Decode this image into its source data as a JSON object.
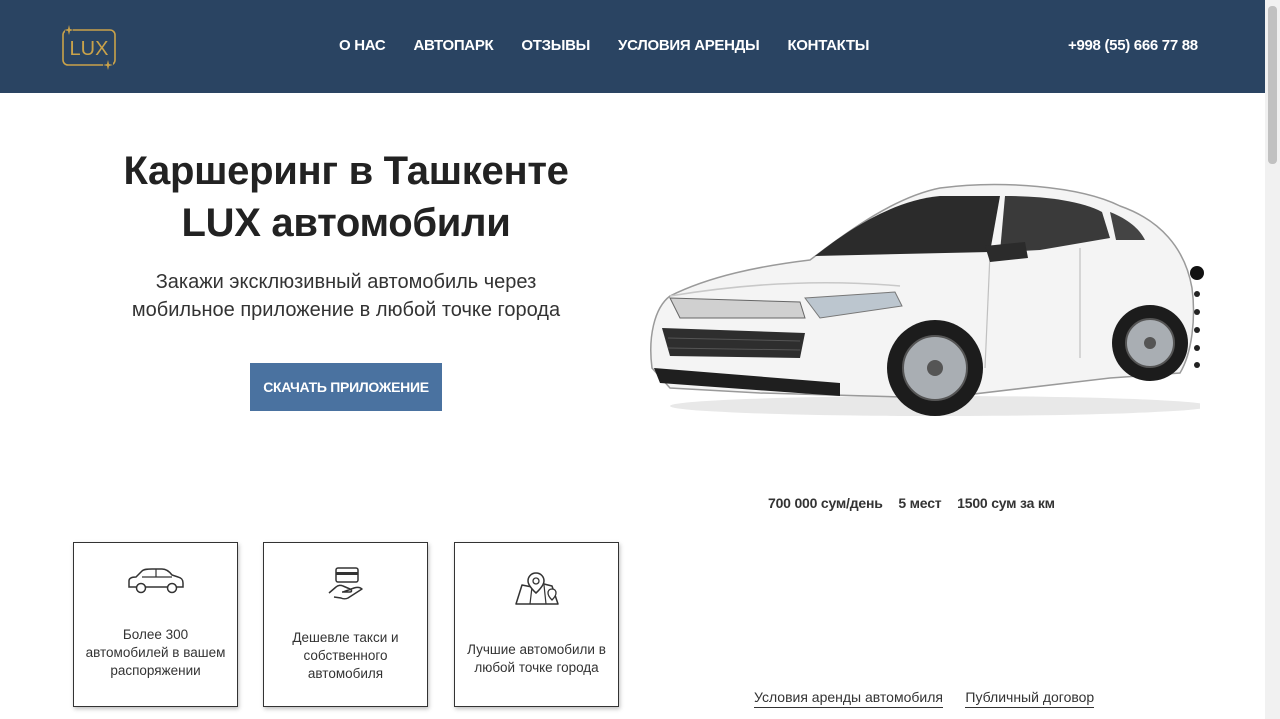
{
  "header": {
    "logo_text": "LUX",
    "nav": [
      {
        "label": "О НАС"
      },
      {
        "label": "АВТОПАРК"
      },
      {
        "label": "ОТЗЫВЫ"
      },
      {
        "label": "УСЛОВИЯ АРЕНДЫ"
      },
      {
        "label": "КОНТАКТЫ"
      }
    ],
    "phone": "+998 (55) 666 77 88"
  },
  "hero": {
    "title_line1": "Каршеринг в Ташкенте",
    "title_line2": "LUX автомобили",
    "subtitle_line1": "Закажи эксклюзивный автомобиль через",
    "subtitle_line2": "мобильное приложение в любой точке города",
    "cta_label": "СКАЧАТЬ ПРИЛОЖЕНИЕ"
  },
  "car": {
    "price": "700 000 сум/день",
    "seats": "5 мест",
    "per_km": "1500 сум за км",
    "slider_dots": 6,
    "active_dot": 1
  },
  "features": [
    {
      "icon": "car-icon",
      "lines": [
        "Более 300",
        "автомобилей в вашем",
        "распоряжении"
      ]
    },
    {
      "icon": "card-hand-icon",
      "lines": [
        "Дешевле такси и",
        "собственного",
        "автомобиля"
      ]
    },
    {
      "icon": "map-pin-icon",
      "lines": [
        "Лучшие автомобили в",
        "любой точке города"
      ]
    }
  ],
  "links": {
    "rental_terms": "Условия аренды автомобиля",
    "public_contract": "Публичный договор"
  },
  "colors": {
    "header_bg": "#2a4462",
    "logo_gold": "#c9a24a",
    "cta_bg": "#4a72a0"
  }
}
